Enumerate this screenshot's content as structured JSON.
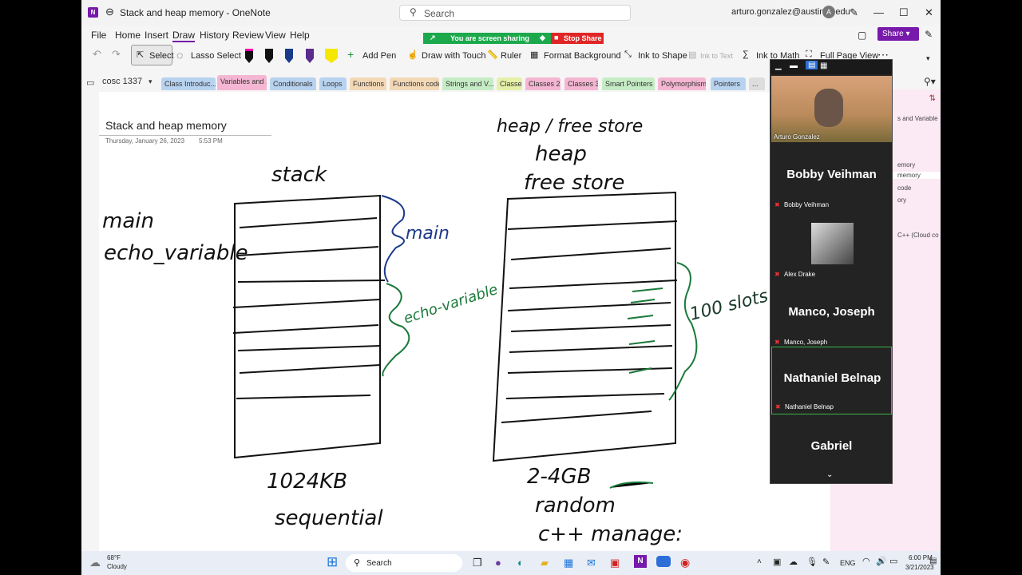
{
  "window": {
    "title": "Stack and heap memory  -  OneNote",
    "account": "arturo.gonzalez@austincc.edu",
    "avatar_letter": "A"
  },
  "search": {
    "placeholder": "Search"
  },
  "menu": [
    "File",
    "Home",
    "Insert",
    "Draw",
    "History",
    "Review",
    "View",
    "Help"
  ],
  "sharing": {
    "banner": "You are screen sharing",
    "stop": "Stop Share"
  },
  "share_button": "Share",
  "ribbon": {
    "select": "Select",
    "lasso": "Lasso Select",
    "add_pen": "Add Pen",
    "draw_touch": "Draw with Touch",
    "ruler": "Ruler",
    "format_bg": "Format Background",
    "ink_shape": "Ink to Shape",
    "ink_text": "Ink to Text",
    "ink_math": "Ink to Math",
    "full_page": "Full Page View"
  },
  "pen_colors": [
    "#111111",
    "#111111",
    "#1a3a8c",
    "#5a2a8c",
    "#f5e800"
  ],
  "notebook": "cosc 1337",
  "tabs": [
    {
      "label": "Class Introduc...",
      "color": "#b8d3f0"
    },
    {
      "label": "Variables and ...",
      "color": "#f4b6d2"
    },
    {
      "label": "Conditionals",
      "color": "#b8d3f0"
    },
    {
      "label": "Loops",
      "color": "#b8d3f0"
    },
    {
      "label": "Functions",
      "color": "#f3d8b6"
    },
    {
      "label": "Functions code",
      "color": "#f3d8b6"
    },
    {
      "label": "Strings and V...",
      "color": "#c6ecc6"
    },
    {
      "label": "Classes",
      "color": "#e6f0a8"
    },
    {
      "label": "Classes 2",
      "color": "#f4b6d2"
    },
    {
      "label": "Classes 3",
      "color": "#f4b6d2"
    },
    {
      "label": "Smart Pointers",
      "color": "#c6ecc6"
    },
    {
      "label": "Polymorphism",
      "color": "#f4b6d2"
    },
    {
      "label": "Pointers",
      "color": "#b8d3f0"
    },
    {
      "label": "...",
      "color": "#dddddd"
    }
  ],
  "page": {
    "title": "Stack and heap memory",
    "date": "Thursday, January 26, 2023",
    "time": "5:53 PM"
  },
  "ink": {
    "stack": "stack",
    "heap_title": "heap / free store",
    "heap": "heap",
    "free_store": "free store",
    "main_left": "main",
    "echo_left": "echo_variable",
    "main_brace": "main",
    "echo_brace": "echo-variable",
    "slots": "100 slots",
    "stack_size": "1024KB",
    "sequential": "sequential",
    "heap_size": "2-4GB",
    "random": "random",
    "manage": "c++ manage:"
  },
  "side_pages": [
    "s and Variable",
    "emory",
    "memory",
    "code",
    "ory",
    "C++ (Cloud co"
  ],
  "zoom": {
    "self": "Arturo Gonzalez",
    "participants": [
      {
        "big": "Bobby Veihman",
        "small": "Bobby Veihman"
      },
      {
        "big": "",
        "small": "Alex Drake"
      },
      {
        "big": "Manco, Joseph",
        "small": "Manco, Joseph"
      },
      {
        "big": "Nathaniel Belnap",
        "small": "Nathaniel Belnap"
      },
      {
        "big": "Gabriel",
        "small": ""
      }
    ]
  },
  "taskbar": {
    "temp": "68°F",
    "weather": "Cloudy",
    "search": "Search",
    "lang": "ENG",
    "time": "6:00 PM",
    "date": "3/21/2023"
  }
}
